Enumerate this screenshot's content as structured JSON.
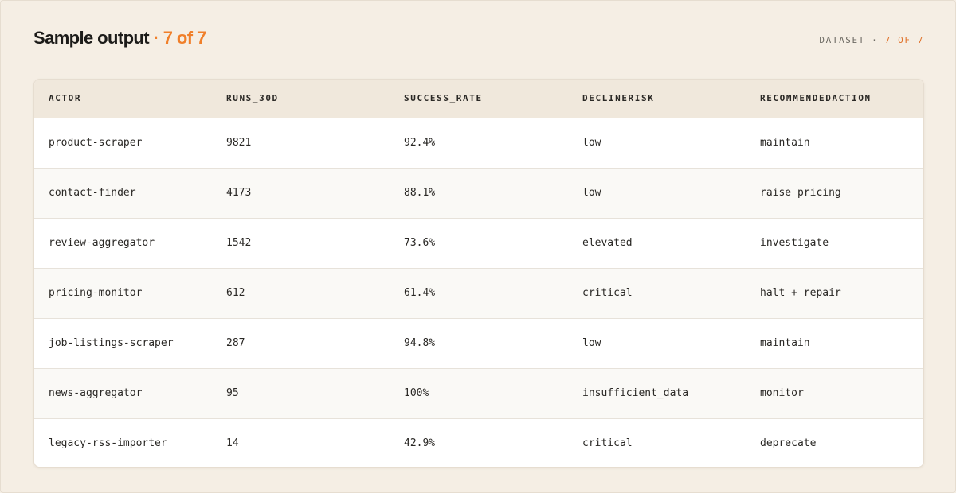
{
  "header": {
    "title": "Sample output",
    "title_suffix": "· 7 of 7",
    "meta_label": "DATASET ·",
    "meta_count": "7 OF 7"
  },
  "table": {
    "columns": [
      "ACTOR",
      "RUNS_30D",
      "SUCCESS_RATE",
      "DECLINERISK",
      "RECOMMENDEDACTION"
    ],
    "rows": [
      [
        "product-scraper",
        "9821",
        "92.4%",
        "low",
        "maintain"
      ],
      [
        "contact-finder",
        "4173",
        "88.1%",
        "low",
        "raise pricing"
      ],
      [
        "review-aggregator",
        "1542",
        "73.6%",
        "elevated",
        "investigate"
      ],
      [
        "pricing-monitor",
        "612",
        "61.4%",
        "critical",
        "halt + repair"
      ],
      [
        "job-listings-scraper",
        "287",
        "94.8%",
        "low",
        "maintain"
      ],
      [
        "news-aggregator",
        "95",
        "100%",
        "insufficient_data",
        "monitor"
      ],
      [
        "legacy-rss-importer",
        "14",
        "42.9%",
        "critical",
        "deprecate"
      ]
    ]
  },
  "colors": {
    "accent": "#f07f2a",
    "background": "#f5eee4",
    "header_row": "#f0e8dc"
  }
}
